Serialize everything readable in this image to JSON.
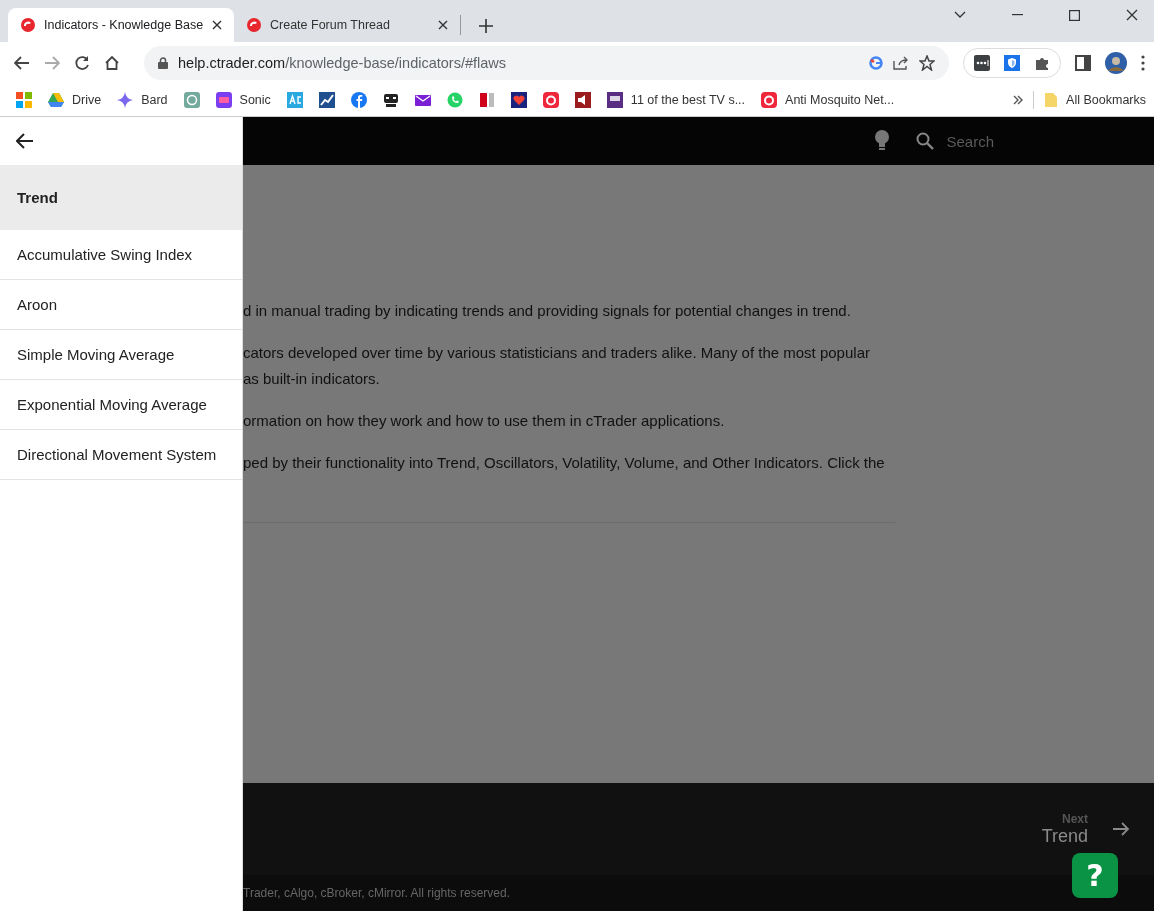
{
  "browser": {
    "tabs": [
      {
        "title": "Indicators - Knowledge Base",
        "selected": true
      },
      {
        "title": "Create Forum Thread",
        "selected": false
      }
    ],
    "address": {
      "host": "help.ctrader.com",
      "path": "/knowledge-base/indicators/#flaws"
    },
    "bookmarks": [
      {
        "kind": "icon"
      },
      {
        "kind": "link",
        "label": "Drive"
      },
      {
        "kind": "link",
        "label": "Bard"
      },
      {
        "kind": "icon"
      },
      {
        "kind": "link",
        "label": "Sonic"
      },
      {
        "kind": "icon"
      },
      {
        "kind": "icon"
      },
      {
        "kind": "icon"
      },
      {
        "kind": "icon"
      },
      {
        "kind": "icon"
      },
      {
        "kind": "icon"
      },
      {
        "kind": "icon"
      },
      {
        "kind": "icon"
      },
      {
        "kind": "icon"
      },
      {
        "kind": "icon"
      },
      {
        "kind": "link",
        "label": "11 of the best TV s..."
      },
      {
        "kind": "link",
        "label": "Anti Mosquito Net..."
      }
    ],
    "all_bookmarks": "All Bookmarks"
  },
  "site": {
    "search_placeholder": "Search",
    "drawer": {
      "section": "Trend",
      "items": [
        "Accumulative Swing Index",
        "Aroon",
        "Simple Moving Average",
        "Exponential Moving Average",
        "Directional Movement System"
      ]
    },
    "paragraphs": [
      {
        "lines": [
          "d in manual trading by indicating trends and providing signals for potential changes in trend."
        ]
      },
      {
        "lines": [
          "cators developed over time by various statisticians and traders alike. Many of the most popular",
          "as built-in indicators."
        ]
      },
      {
        "lines": [
          "ormation on how they work and how to use them in cTrader applications."
        ]
      },
      {
        "lines": [
          "ped by their functionality into Trend, Oscillators, Volatility, Volume, and Other Indicators. Click the"
        ]
      }
    ],
    "next": {
      "caption": "Next",
      "title": "Trend"
    },
    "copyright": "Trader, cAlgo, cBroker, cMirror. All rights reserved.",
    "help_button": "?"
  }
}
